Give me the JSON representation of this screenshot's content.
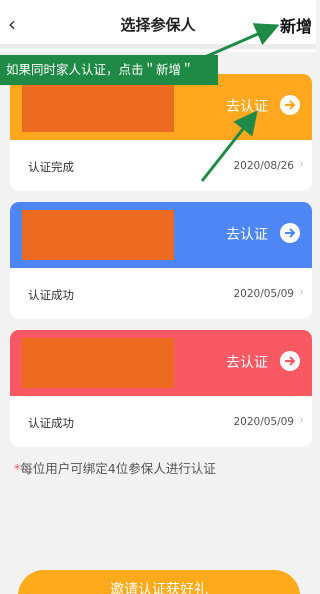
{
  "header": {
    "back_icon": "back-chevron-icon",
    "back_glyph": "‹",
    "title": "选择参保人",
    "add_label": "新增"
  },
  "annotation": {
    "text": "如果同时家人认证，点击＂新增＂",
    "bg_color": "#1e8a45",
    "arrow_color": "#1e8a45"
  },
  "cards": [
    {
      "color": "#ffa81f",
      "action_label": "去认证",
      "status": "认证完成",
      "date": "2020/08/26"
    },
    {
      "color": "#4f86f5",
      "action_label": "去认证",
      "status": "认证成功",
      "date": "2020/05/09"
    },
    {
      "color": "#f95963",
      "action_label": "去认证",
      "status": "认证成功",
      "date": "2020/05/09"
    }
  ],
  "note": {
    "asterisk": "*",
    "text": "每位用户可绑定4位参保人进行认证"
  },
  "bottom_button": {
    "label": "邀请认证获好礼"
  },
  "colors": {
    "redaction": "#ec6b20",
    "background": "#f2f2f2"
  }
}
